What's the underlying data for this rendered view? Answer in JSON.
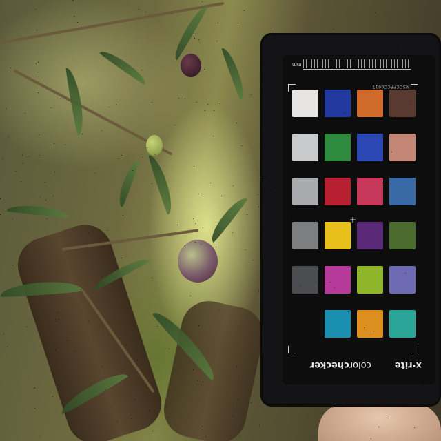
{
  "photo": {
    "subject": "olive-branch-with-colorchecker"
  },
  "colorchecker": {
    "ruler_unit": "mm",
    "serial": "MSCCPPCC0617",
    "brand_logo": "x·rite",
    "product_name_regular": "color",
    "product_name_bold": "checker",
    "crosshair_glyph": "+",
    "patch_colors": [
      [
        "#e7e5e3",
        "#223aa0",
        "#cf6a2a",
        "#5a3a30"
      ],
      [
        "#c9cacc",
        "#2e8a3e",
        "#2a47b4",
        "#c48676"
      ],
      [
        "#a9aaad",
        "#b72031",
        "#c7395a",
        "#3a6aa6"
      ],
      [
        "#7d7e80",
        "#e8c01c",
        "#5a2a78",
        "#4a6a2e"
      ],
      [
        "#4c4d50",
        "#b63a9a",
        "#8fb52a",
        "#6e6bb3"
      ],
      [
        null,
        "#1a8fb0",
        "#dc8e1e",
        "#2aa497"
      ]
    ]
  }
}
